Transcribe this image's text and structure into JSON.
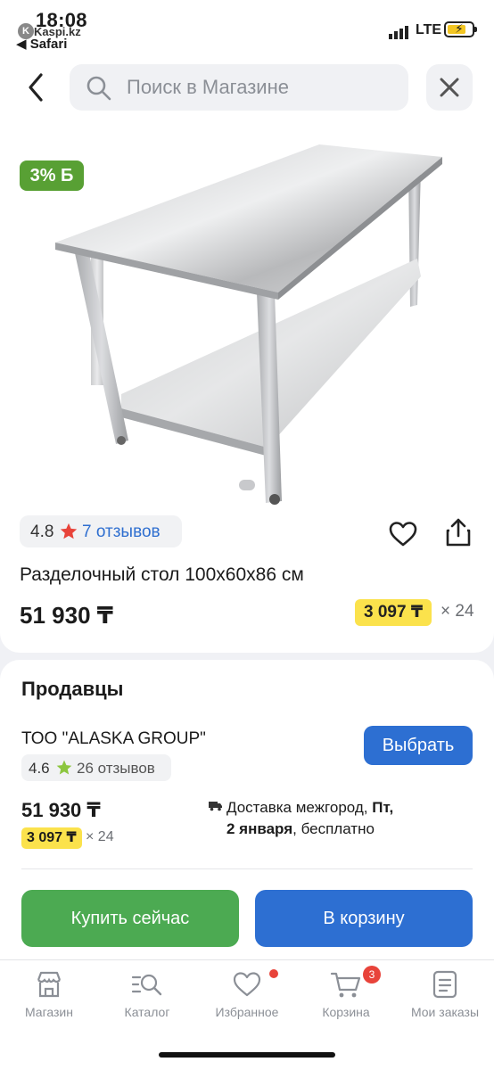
{
  "status": {
    "time": "18:08",
    "back_app": "◀ Safari",
    "host": "Kaspi.kz",
    "network": "LTE"
  },
  "search": {
    "placeholder": "Поиск в Магазине"
  },
  "product": {
    "cashback": "3% Б",
    "rating": "4.8",
    "reviews": "7 отзывов",
    "title": "Разделочный стол 100x60x86 см",
    "price": "51 930 ₸",
    "installment": "3 097 ₸",
    "installment_times": "× 24"
  },
  "sellers": {
    "title": "Продавцы",
    "name": "ТОО \"ALASKA GROUP\"",
    "rating": "4.6",
    "reviews": "26 отзывов",
    "select_label": "Выбрать",
    "price": "51 930 ₸",
    "installment": "3 097 ₸",
    "installment_times": "× 24",
    "delivery_prefix": "Доставка межгород, ",
    "delivery_day": "Пт,",
    "delivery_date": "2 января",
    "delivery_suffix": ", бесплатно",
    "buy_label": "Купить сейчас",
    "cart_label": "В корзину"
  },
  "nav": {
    "items": [
      {
        "label": "Магазин",
        "icon": "store-icon"
      },
      {
        "label": "Каталог",
        "icon": "catalog-search-icon"
      },
      {
        "label": "Избранное",
        "icon": "heart-icon"
      },
      {
        "label": "Корзина",
        "icon": "cart-icon",
        "count": "3"
      },
      {
        "label": "Мои заказы",
        "icon": "orders-icon"
      }
    ]
  },
  "colors": {
    "accent_blue": "#2d6fd2",
    "buy_green": "#4caa52",
    "cashback_green": "#58a034",
    "installment_yellow": "#fbe24c",
    "badge_red": "#e8433a"
  }
}
